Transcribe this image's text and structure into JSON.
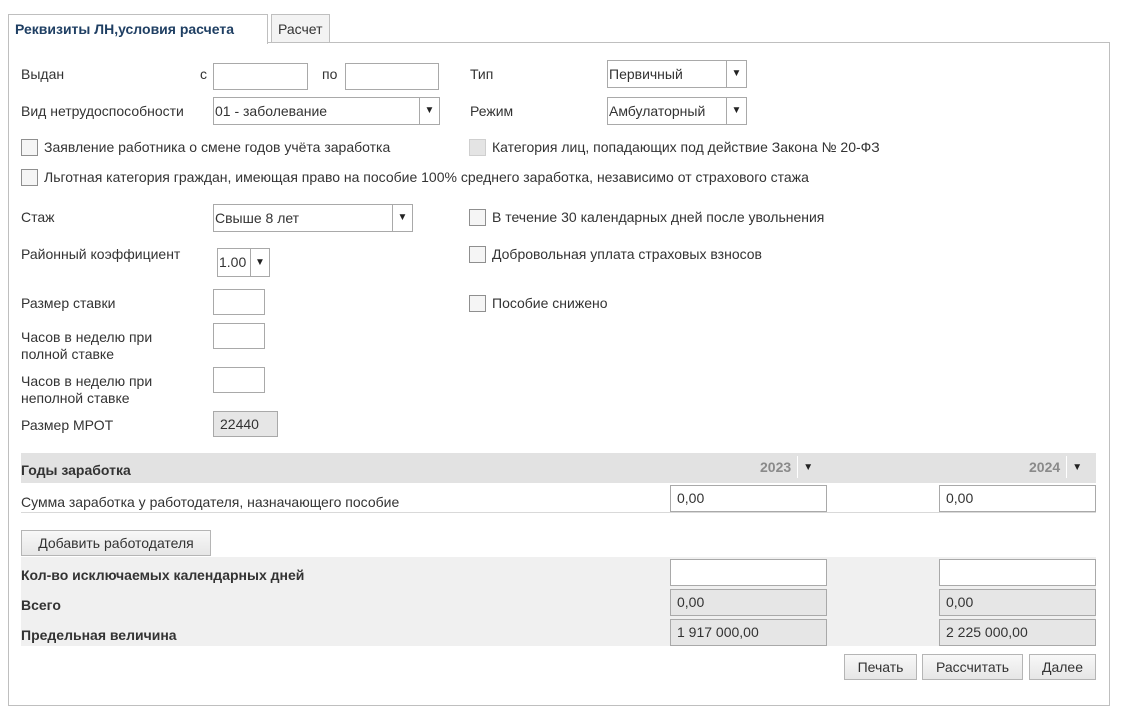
{
  "tabs": [
    {
      "label": "Реквизиты ЛН,условия расчета",
      "active": true
    },
    {
      "label": "Расчет",
      "active": false
    }
  ],
  "form": {
    "issued_label": "Выдан",
    "from_label": "с",
    "from_value": "",
    "to_label": "по",
    "to_value": "",
    "type_label": "Тип",
    "type_value": "Первичный",
    "disability_label": "Вид нетрудоспособности",
    "disability_value": "01 - заболевание",
    "mode_label": "Режим",
    "mode_value": "Амбулаторный",
    "cb_years_change": "Заявление работника о смене годов учёта заработка",
    "cb_category_20fz": "Категория лиц, попадающих под действие Закона № 20-ФЗ",
    "cb_privileged": "Льготная категория граждан, имеющая право на пособие 100% среднего заработка, независимо от страхового стажа",
    "experience_label": "Стаж",
    "experience_value": "Свыше 8 лет",
    "cb_30_days": "В течение 30 календарных дней после увольнения",
    "district_coef_label": "Районный коэффициент",
    "district_coef_value": "1.00",
    "cb_voluntary": "Добровольная уплата страховых взносов",
    "rate_label": "Размер ставки",
    "rate_value": "",
    "cb_reduced": "Пособие снижено",
    "hours_full_label": "Часов в неделю при полной ставке",
    "hours_full_value": "",
    "hours_part_label": "Часов в неделю при неполной ставке",
    "hours_part_value": "",
    "mrot_label": "Размер МРОТ",
    "mrot_value": "22440"
  },
  "earnings": {
    "years_label": "Годы заработка",
    "year1": "2023",
    "year2": "2024",
    "sum_label": "Сумма заработка у работодателя, назначающего пособие",
    "sum1": "0,00",
    "sum2": "0,00",
    "add_employer": "Добавить работодателя",
    "excluded_label": "Кол-во исключаемых календарных дней",
    "excluded1": "",
    "excluded2": "",
    "total_label": "Всего",
    "total1": "0,00",
    "total2": "0,00",
    "limit_label": "Предельная величина",
    "limit1": "1 917 000,00",
    "limit2": "2 225 000,00"
  },
  "buttons": {
    "print": "Печать",
    "calculate": "Рассчитать",
    "next": "Далее"
  },
  "icons": {
    "dropdown": "triangle-down-icon"
  },
  "colors": {
    "active_tab_text": "#1f3f63",
    "band_bg": "#e2e2e2",
    "readonly_bg": "#e6e6e6"
  }
}
